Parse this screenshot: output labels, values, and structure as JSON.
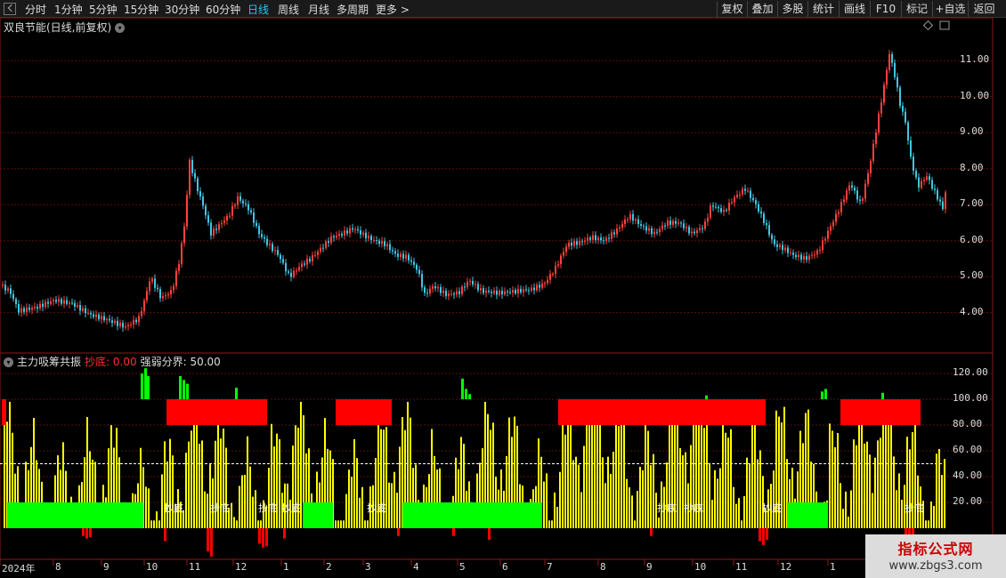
{
  "toolbar": {
    "periods": [
      "分时",
      "1分钟",
      "5分钟",
      "15分钟",
      "30分钟",
      "60分钟",
      "日线",
      "周线",
      "月线",
      "多周期",
      "更多 >"
    ],
    "active_period": "日线",
    "right_buttons": [
      "复权",
      "叠加",
      "多股",
      "统计",
      "画线",
      "F10",
      "标记",
      "+自选",
      "返回"
    ]
  },
  "stock": {
    "title": "双良节能(日线,前复权)"
  },
  "price_axis": {
    "labels": [
      "11.00",
      "10.00",
      "9.00",
      "8.00",
      "7.00",
      "6.00",
      "5.00",
      "4.00"
    ],
    "range": [
      3.3,
      11.7
    ]
  },
  "indicator": {
    "name": "主力吸筹共振",
    "chaodi_label": "抄底: 0.00",
    "threshold_label": "强弱分界: 50.00",
    "axis_labels": [
      "120.00",
      "100.00",
      "80.00",
      "60.00",
      "40.00",
      "20.00"
    ],
    "threshold": 50,
    "signal_text": "抄底"
  },
  "time_axis": [
    "2024年",
    "8",
    "9",
    "10",
    "11",
    "12",
    "1",
    "2",
    "3",
    "4",
    "5",
    "6",
    "7",
    "8",
    "9",
    "10",
    "11",
    "12",
    "1"
  ],
  "watermark": {
    "title": "指标公式网",
    "url": "www.zbgs3.com"
  },
  "colors": {
    "up": "#ff4040",
    "down": "#3ec8e0",
    "yellow": "#ffff00",
    "green": "#00ff00",
    "red": "#ff0000",
    "active": "#27c7f0"
  }
}
